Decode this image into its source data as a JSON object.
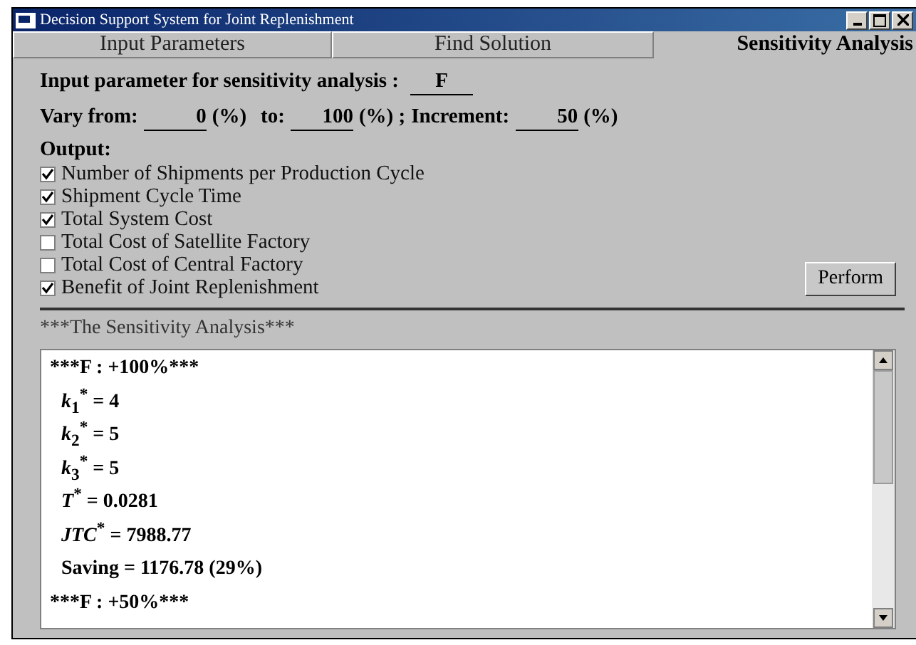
{
  "window": {
    "title": "Decision Support System for Joint Replenishment"
  },
  "tabs": [
    {
      "label": "Input Parameters",
      "selected": false
    },
    {
      "label": "Find Solution",
      "selected": false
    },
    {
      "label": "Sensitivity Analysis",
      "selected": true
    }
  ],
  "parameter": {
    "label": "Input parameter for sensitivity analysis :",
    "value": "F"
  },
  "range": {
    "from_label": "Vary from:",
    "from": "0",
    "from_unit": "(%)",
    "to_label": "to:",
    "to": "100",
    "to_unit": "(%) ;",
    "increment_label": "Increment:",
    "increment": "50",
    "increment_unit": "(%)"
  },
  "output": {
    "label": "Output:",
    "options": [
      {
        "label": "Number of Shipments per Production Cycle",
        "checked": true
      },
      {
        "label": "Shipment Cycle Time",
        "checked": true
      },
      {
        "label": "Total System Cost",
        "checked": true
      },
      {
        "label": "Total Cost of Satellite Factory",
        "checked": false
      },
      {
        "label": "Total Cost of Central Factory",
        "checked": false
      },
      {
        "label": "Benefit of Joint Replenishment",
        "checked": true
      }
    ]
  },
  "perform_button": "Perform",
  "results": {
    "title": "***The Sensitivity Analysis***",
    "lines": [
      {
        "kind": "header",
        "text": "***F : +100%***"
      },
      {
        "kind": "value",
        "text": "*k*$_{1}$$^{*}$ = 4"
      },
      {
        "kind": "value",
        "text": "*k*$_{2}$$^{*}$ = 5"
      },
      {
        "kind": "value",
        "text": "*k*$_{3}$$^{*}$ = 5"
      },
      {
        "kind": "value",
        "text": "*T*$^{*}$ = 0.0281"
      },
      {
        "kind": "value",
        "text": "*JTC*$^{*}$ = 7988.77"
      },
      {
        "kind": "value",
        "text": "Saving = 1176.78 (29%)"
      },
      {
        "kind": "header",
        "text": "***F : +50%***"
      }
    ]
  }
}
